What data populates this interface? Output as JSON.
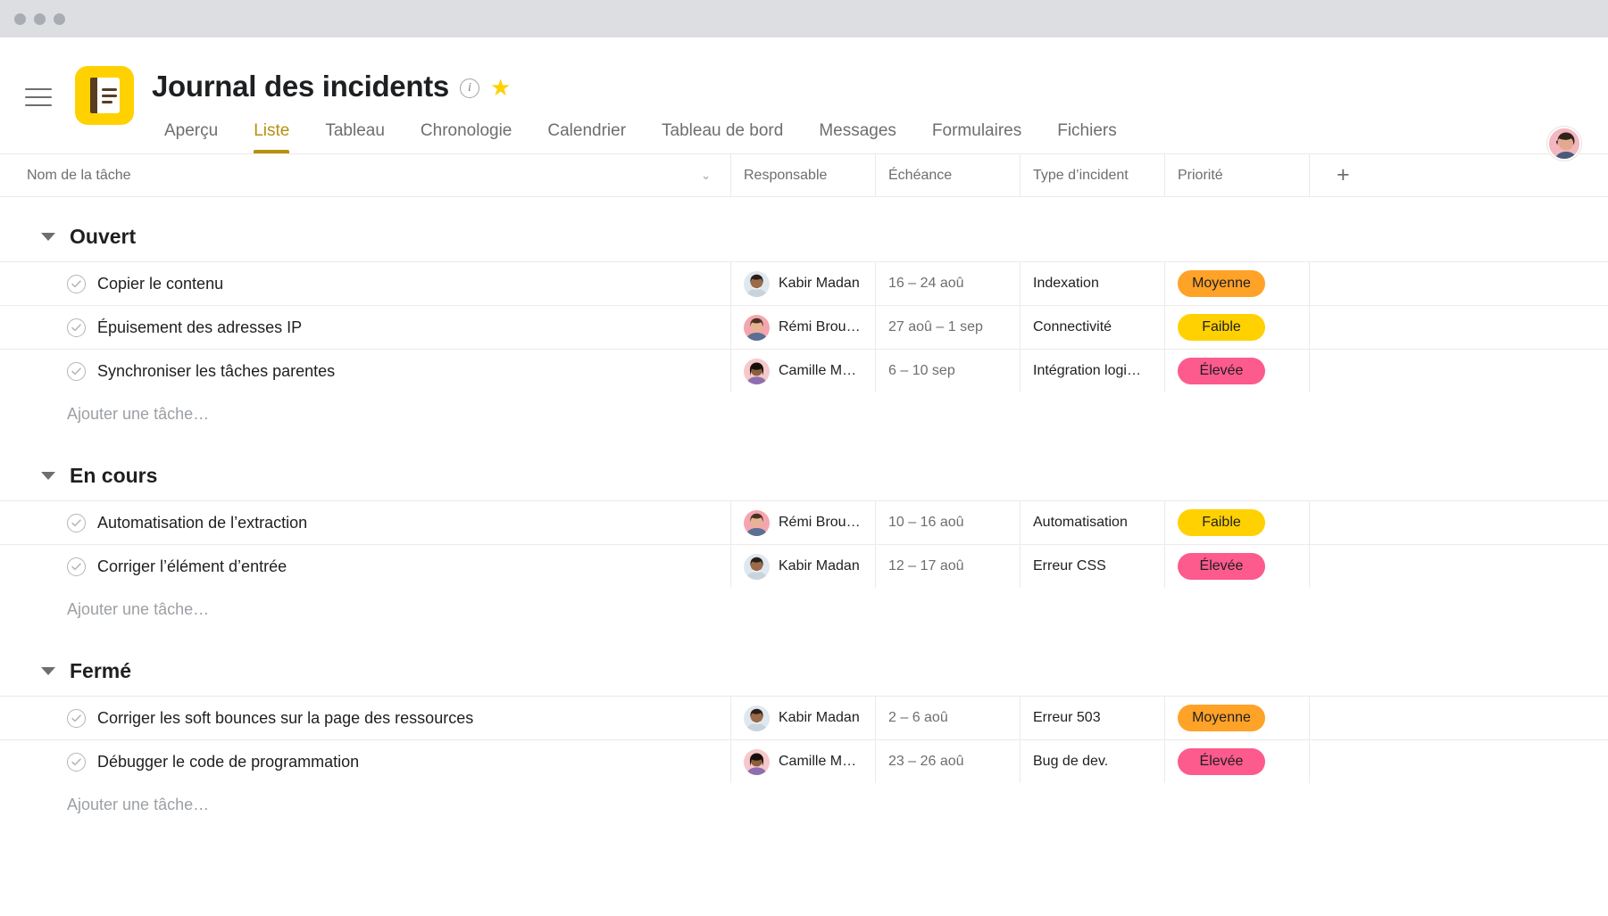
{
  "window": {
    "dots": [
      "red",
      "yellow",
      "green"
    ]
  },
  "header": {
    "menu_icon": "hamburger-icon",
    "project_icon": "notebook-icon",
    "title": "Journal des incidents",
    "info_icon": "i",
    "info_icon_name": "info-icon",
    "star_icon": "★",
    "star_icon_name": "star-icon",
    "avatar_name": "user-avatar"
  },
  "tabs": [
    {
      "label": "Aperçu",
      "active": false
    },
    {
      "label": "Liste",
      "active": true
    },
    {
      "label": "Tableau",
      "active": false
    },
    {
      "label": "Chronologie",
      "active": false
    },
    {
      "label": "Calendrier",
      "active": false
    },
    {
      "label": "Tableau de bord",
      "active": false
    },
    {
      "label": "Messages",
      "active": false
    },
    {
      "label": "Formulaires",
      "active": false
    },
    {
      "label": "Fichiers",
      "active": false
    }
  ],
  "table": {
    "columns": {
      "task": "Nom de la tâche",
      "assignee": "Responsable",
      "due": "Échéance",
      "type": "Type d’incident",
      "priority": "Priorité",
      "add_column": "+"
    },
    "sort_chevron": "⌄",
    "add_task_placeholder": "Ajouter une tâche…"
  },
  "colors": {
    "brand_yellow": "#ffd100",
    "accent_active_tab": "#b7900e",
    "priority_moyenne": "#ffa228",
    "priority_faible": "#ffd100",
    "priority_elevee": "#fd5a8e",
    "row_border": "#edeae9",
    "text_primary": "#1e1f21",
    "text_muted": "#6d6e6f"
  },
  "sections": [
    {
      "name": "Ouvert",
      "collapsed": false,
      "tasks": [
        {
          "name": "Copier le contenu",
          "assignee": "Kabir Madan",
          "avatar": "kabir",
          "due": "16 – 24 aoû",
          "type": "Indexation",
          "priority": "Moyenne",
          "priority_class": "moyenne"
        },
        {
          "name": "Épuisement des adresses IP",
          "assignee": "Rémi Brousse",
          "avatar": "remi",
          "due": "27 aoû – 1 sep",
          "type": "Connectivité",
          "priority": "Faible",
          "priority_class": "faible"
        },
        {
          "name": "Synchroniser les tâches parentes",
          "assignee": "Camille Mou…",
          "avatar": "camille",
          "due": "6 – 10 sep",
          "type": "Intégration logi…",
          "priority": "Élevée",
          "priority_class": "elevee"
        }
      ]
    },
    {
      "name": "En cours",
      "collapsed": false,
      "tasks": [
        {
          "name": "Automatisation de l’extraction",
          "assignee": "Rémi Brousse",
          "avatar": "remi",
          "due": "10 – 16 aoû",
          "type": "Automatisation",
          "priority": "Faible",
          "priority_class": "faible"
        },
        {
          "name": "Corriger l’élément d’entrée",
          "assignee": "Kabir Madan",
          "avatar": "kabir",
          "due": "12 – 17 aoû",
          "type": "Erreur CSS",
          "priority": "Élevée",
          "priority_class": "elevee"
        }
      ]
    },
    {
      "name": "Fermé",
      "collapsed": false,
      "tasks": [
        {
          "name": "Corriger les soft bounces sur la page des ressources",
          "assignee": "Kabir Madan",
          "avatar": "kabir",
          "due": "2 – 6 aoû",
          "type": "Erreur 503",
          "priority": "Moyenne",
          "priority_class": "moyenne"
        },
        {
          "name": "Débugger le code de programmation",
          "assignee": "Camille Mou…",
          "avatar": "camille",
          "due": "23 – 26 aoû",
          "type": "Bug de dev.",
          "priority": "Élevée",
          "priority_class": "elevee"
        }
      ]
    }
  ]
}
